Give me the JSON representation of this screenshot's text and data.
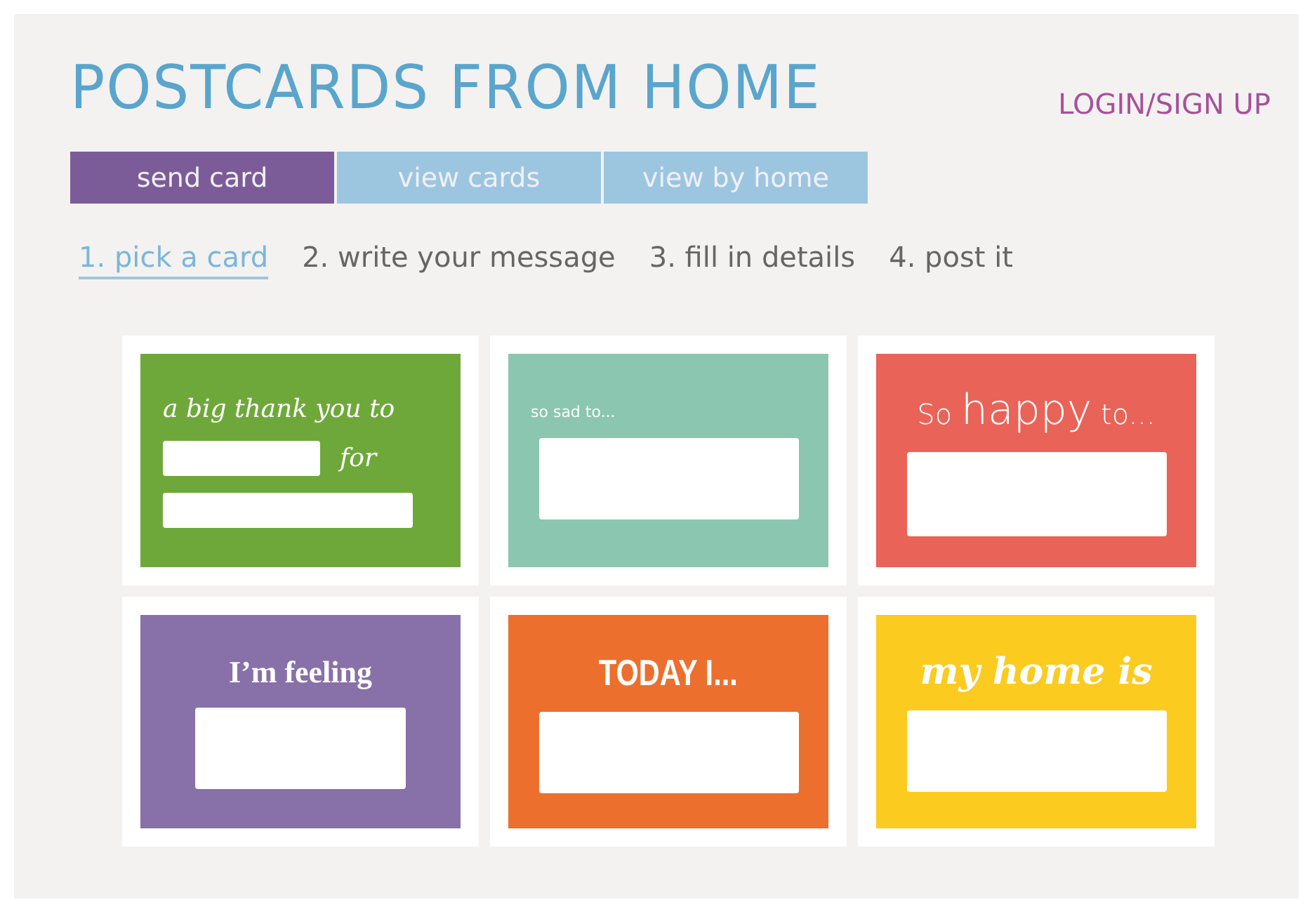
{
  "site": {
    "title": "POSTCARDS FROM HOME",
    "login": "LOGIN/SIGN UP"
  },
  "tabs": [
    {
      "label": "send card",
      "selected": true
    },
    {
      "label": "view cards",
      "selected": false
    },
    {
      "label": "view by home",
      "selected": false
    }
  ],
  "steps": [
    {
      "label": "1. pick a card",
      "selected": true
    },
    {
      "label": "2. write your message",
      "selected": false
    },
    {
      "label": "3. fill in details",
      "selected": false
    },
    {
      "label": "4. post it",
      "selected": false
    }
  ],
  "cards": [
    {
      "kind": "thanks",
      "color": "#6fa83a",
      "parts": [
        {
          "text": "a big thank you to",
          "emphasis": false
        }
      ],
      "connector": "for"
    },
    {
      "kind": "single",
      "color": "#8bc6b1",
      "parts": [
        {
          "text": "so sad to...",
          "emphasis": false
        }
      ]
    },
    {
      "kind": "single",
      "color": "#e96358",
      "parts": [
        {
          "text": "So",
          "emphasis": false
        },
        {
          "text": "happy",
          "emphasis": true
        },
        {
          "text": "to...",
          "emphasis": false
        }
      ]
    },
    {
      "kind": "single",
      "color": "#8870a8",
      "parts": [
        {
          "text": "I’m feeling",
          "emphasis": false
        }
      ]
    },
    {
      "kind": "single",
      "color": "#ec6f2d",
      "parts": [
        {
          "text": "TODAY I...",
          "emphasis": false
        }
      ]
    },
    {
      "kind": "single",
      "color": "#fccb20",
      "parts": [
        {
          "text": "my home is",
          "emphasis": false
        }
      ]
    }
  ]
}
